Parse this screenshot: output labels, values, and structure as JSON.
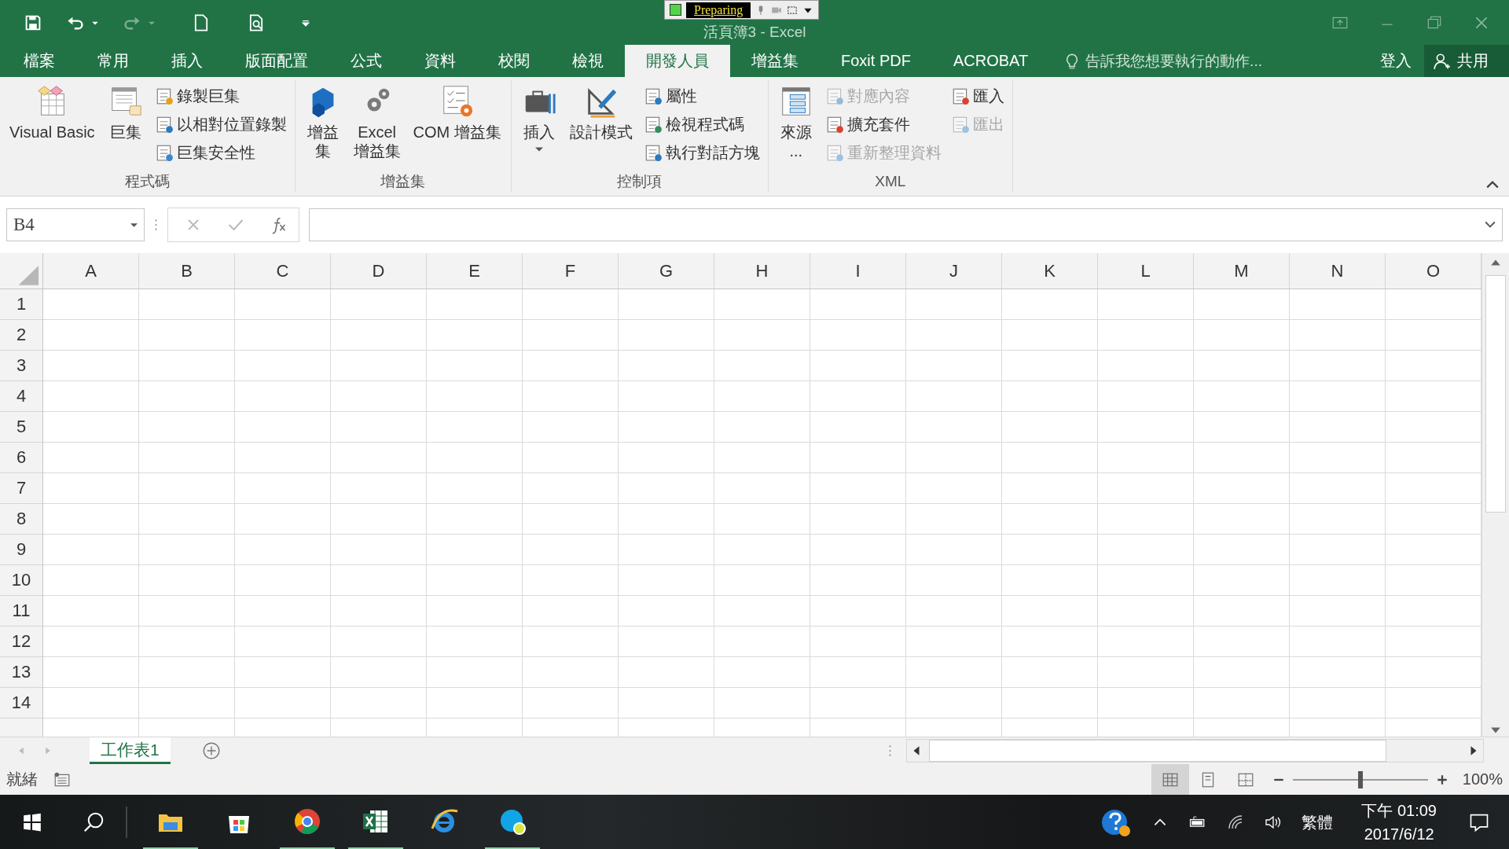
{
  "title_bar": {
    "title": "活頁簿3 - Excel",
    "recorder": {
      "status": "Preparing"
    }
  },
  "tabs": [
    {
      "label": "檔案",
      "selected": false
    },
    {
      "label": "常用",
      "selected": false
    },
    {
      "label": "插入",
      "selected": false
    },
    {
      "label": "版面配置",
      "selected": false
    },
    {
      "label": "公式",
      "selected": false
    },
    {
      "label": "資料",
      "selected": false
    },
    {
      "label": "校閱",
      "selected": false
    },
    {
      "label": "檢視",
      "selected": false
    },
    {
      "label": "開發人員",
      "selected": true
    },
    {
      "label": "增益集",
      "selected": false
    },
    {
      "label": "Foxit PDF",
      "selected": false
    },
    {
      "label": "ACROBAT",
      "selected": false
    }
  ],
  "tell_me": {
    "placeholder": "告訴我您想要執行的動作..."
  },
  "sign_in": "登入",
  "share": "共用",
  "ribbon_groups": [
    {
      "label": "程式碼",
      "columns": [
        {
          "kind": "large",
          "label": "Visual Basic"
        },
        {
          "kind": "large",
          "label": "巨集"
        },
        {
          "kind": "stack",
          "items": [
            {
              "label": "錄製巨集",
              "disabled": false
            },
            {
              "label": "以相對位置錄製",
              "disabled": false
            },
            {
              "label": "巨集安全性",
              "disabled": false
            }
          ]
        }
      ]
    },
    {
      "label": "增益集",
      "columns": [
        {
          "kind": "large",
          "label": "增益集"
        },
        {
          "kind": "large",
          "label": "Excel\n增益集"
        },
        {
          "kind": "large",
          "label": "COM 增益集"
        }
      ]
    },
    {
      "label": "控制項",
      "columns": [
        {
          "kind": "dropdown",
          "label": "插入"
        },
        {
          "kind": "large",
          "label": "設計模式"
        },
        {
          "kind": "stack",
          "items": [
            {
              "label": "屬性",
              "disabled": false
            },
            {
              "label": "檢視程式碼",
              "disabled": false
            },
            {
              "label": "執行對話方塊",
              "disabled": false
            }
          ]
        }
      ]
    },
    {
      "label": "XML",
      "columns": [
        {
          "kind": "large",
          "label": "來源\n..."
        },
        {
          "kind": "stack",
          "items": [
            {
              "label": "對應內容",
              "disabled": true
            },
            {
              "label": "擴充套件",
              "disabled": false
            },
            {
              "label": "重新整理資料",
              "disabled": true
            }
          ]
        },
        {
          "kind": "stack",
          "items": [
            {
              "label": "匯入",
              "disabled": false
            },
            {
              "label": "匯出",
              "disabled": true
            }
          ]
        }
      ]
    }
  ],
  "formula_bar": {
    "name_box": "B4"
  },
  "columns": [
    "A",
    "B",
    "C",
    "D",
    "E",
    "F",
    "G",
    "H",
    "I",
    "J",
    "K",
    "L",
    "M",
    "N",
    "O"
  ],
  "rows": [
    "1",
    "2",
    "3",
    "4",
    "5",
    "6",
    "7",
    "8",
    "9",
    "10",
    "11",
    "12",
    "13",
    "14"
  ],
  "sheet_tabs": [
    {
      "label": "工作表1",
      "selected": true
    }
  ],
  "status_bar": {
    "status": "就緒",
    "views": [
      {
        "selected": true
      },
      {
        "selected": false
      },
      {
        "selected": false
      }
    ],
    "zoom": {
      "level": 0.5,
      "reading": "100%"
    }
  },
  "taskbar": {
    "apps": [
      {
        "running": true
      },
      {
        "running": false
      },
      {
        "running": true
      },
      {
        "running": true
      },
      {
        "running": false
      },
      {
        "running": true
      }
    ],
    "input_method": "繁體",
    "time": "下午 01:09",
    "date": "2017/6/12"
  }
}
